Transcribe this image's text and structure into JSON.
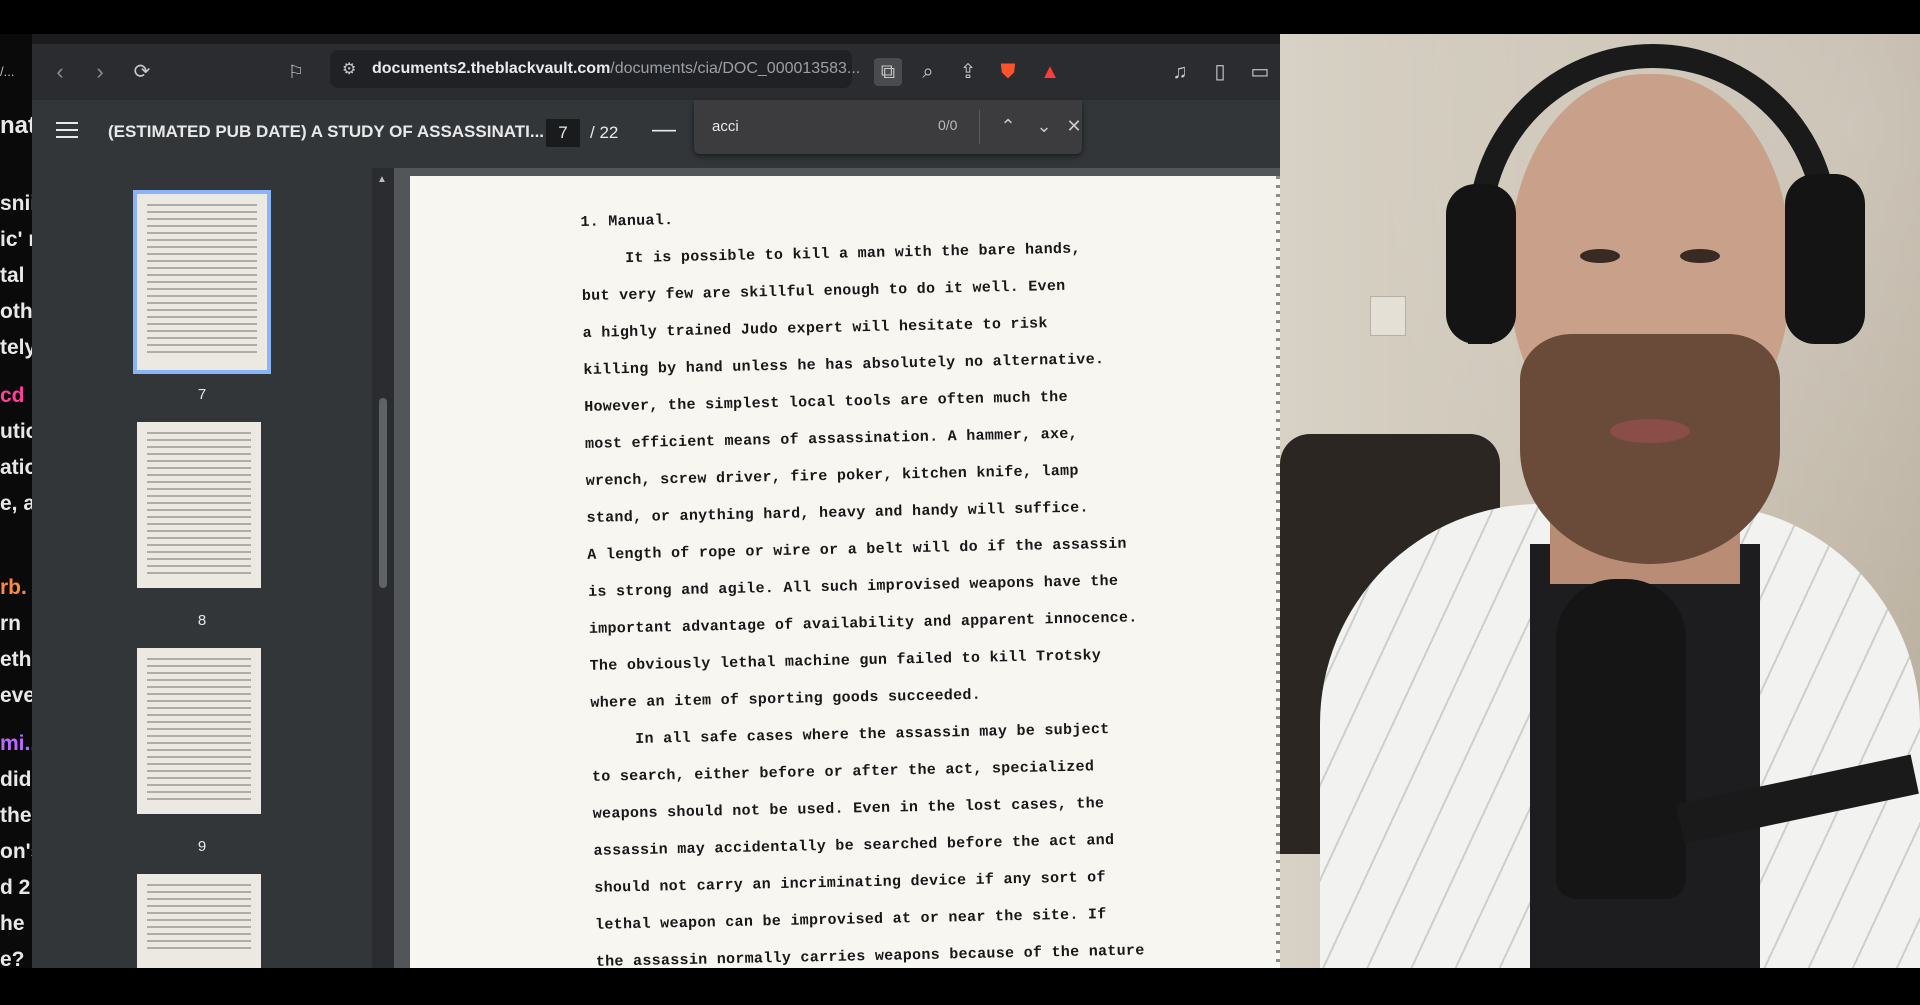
{
  "chat": {
    "fragments": [
      "nat",
      "snii",
      "ic' n",
      "tal",
      "oth",
      "tely",
      "cd",
      "utic",
      "atio",
      "e, a",
      "rb.",
      "rn",
      "ethi",
      "eve",
      "mi..",
      "did",
      "the",
      "on's",
      "d 2",
      "he",
      "e?"
    ],
    "left_small_text": "/..."
  },
  "browser": {
    "address": {
      "url_domain": "documents2.theblackvault.com",
      "url_path": "/documents/cia/DOC_000013583..."
    },
    "pdf_toolbar": {
      "title": "(ESTIMATED PUB DATE) A STUDY OF ASSASSINATI...",
      "current_page": "7",
      "total_pages": "/ 22",
      "zoom_out": "—"
    },
    "find": {
      "query": "acci",
      "count": "0/0"
    },
    "thumbnails": [
      {
        "label": "7",
        "selected": true
      },
      {
        "label": "8",
        "selected": false
      },
      {
        "label": "9",
        "selected": false
      },
      {
        "label": "",
        "selected": false
      }
    ],
    "page_lines": [
      "1.  Manual.",
      "It is possible to kill a man with the bare hands,",
      "but very few are skillful enough to do it well.  Even",
      "a highly trained Judo expert will hesitate to risk",
      "killing by hand unless he has absolutely no alternative.",
      "However, the simplest local tools are often much the",
      "most efficient means of assassination.  A hammer, axe,",
      "wrench, screw driver, fire poker, kitchen knife, lamp",
      "stand, or anything hard, heavy and handy will suffice.",
      "A length of rope or wire or a belt will do if the assassin",
      "is strong and agile.  All such improvised weapons have the",
      "important advantage of availability and apparent innocence.",
      "The obviously lethal machine gun failed to kill Trotsky",
      "where an item of sporting goods succeeded.",
      "In all safe cases where the assassin may be subject",
      "to search, either before or after the act, specialized",
      "weapons should not be used.  Even in the lost cases, the",
      "assassin may accidentally be searched before the act and",
      "should not carry an incriminating device if any sort of",
      "lethal weapon can be improvised at or near the site.  If",
      "the assassin normally carries weapons because of the nature"
    ]
  }
}
